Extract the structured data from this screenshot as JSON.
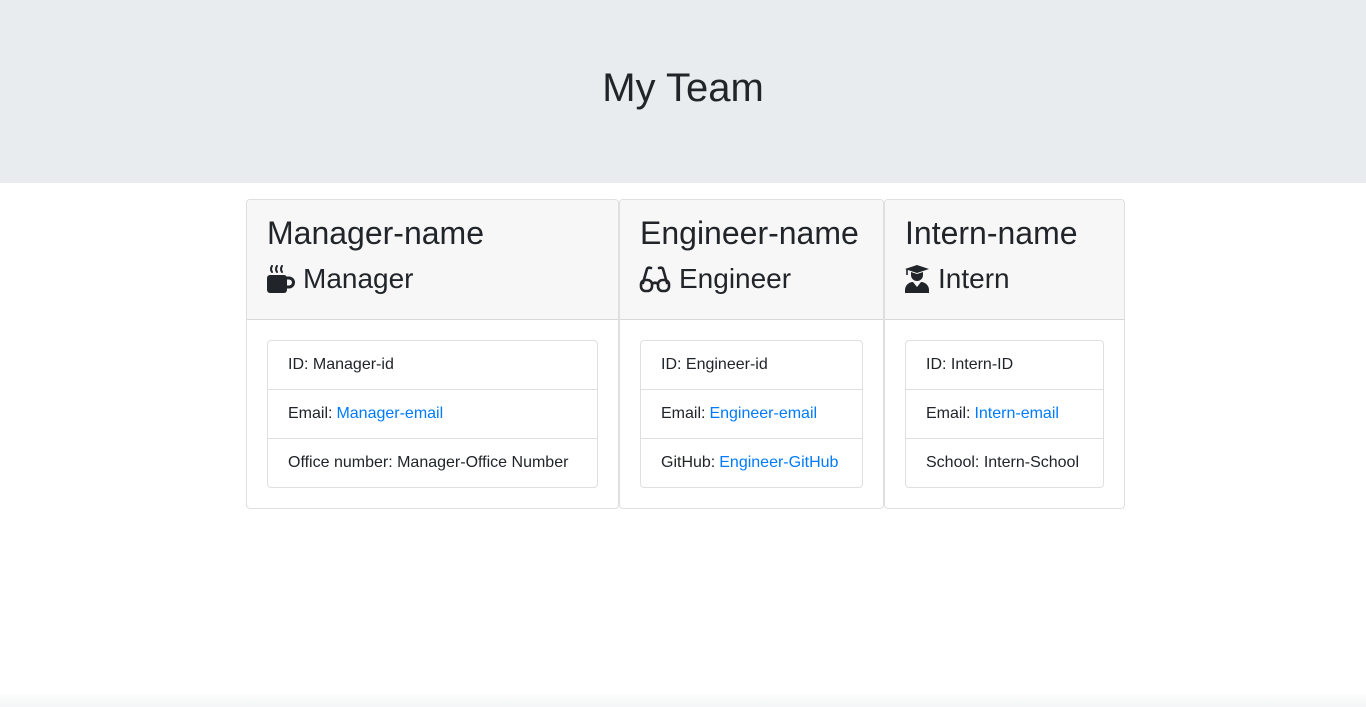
{
  "header": {
    "title": "My Team"
  },
  "cards": [
    {
      "name": "Manager-name",
      "role": "Manager",
      "icon": "coffee-icon",
      "id_label": "ID:",
      "id_value": "Manager-id",
      "email_label": "Email:",
      "email_value": "Manager-email",
      "extra_label": "Office number:",
      "extra_value": "Manager-Office Number"
    },
    {
      "name": "Engineer-name",
      "role": "Engineer",
      "icon": "glasses-icon",
      "id_label": "ID:",
      "id_value": "Engineer-id",
      "email_label": "Email:",
      "email_value": "Engineer-email",
      "extra_label": "GitHub:",
      "extra_value": "Engineer-GitHub"
    },
    {
      "name": "Intern-name",
      "role": "Intern",
      "icon": "user-graduate-icon",
      "id_label": "ID:",
      "id_value": "Intern-ID",
      "email_label": "Email:",
      "email_value": "Intern-email",
      "extra_label": "School:",
      "extra_value": "Intern-School"
    }
  ],
  "colors": {
    "jumbotron_bg": "#e9ecef",
    "card_header_bg": "#f7f7f7",
    "link": "#007bff",
    "text": "#212529"
  }
}
